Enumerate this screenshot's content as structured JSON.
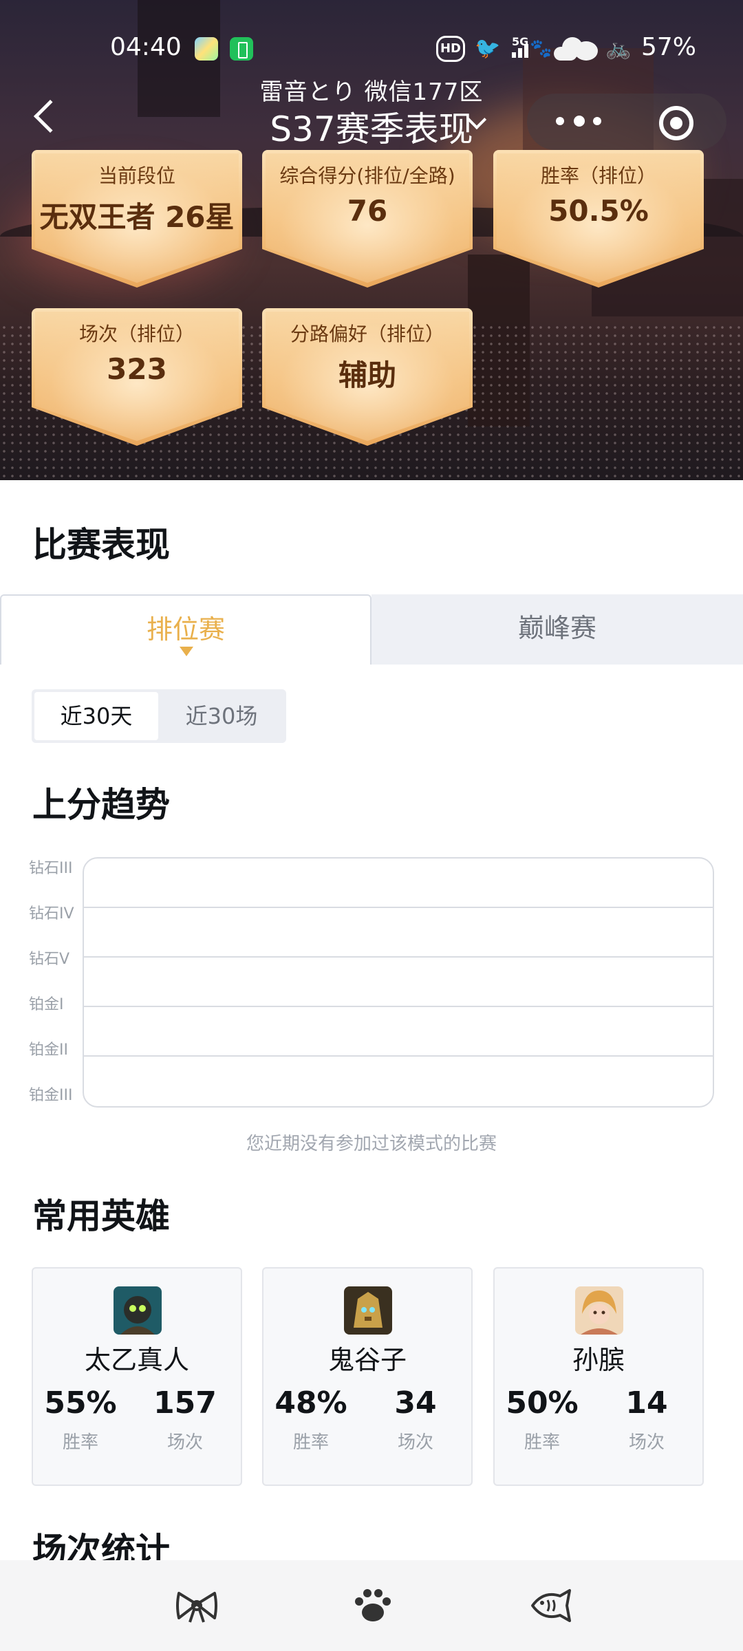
{
  "status_bar": {
    "time": "04:40",
    "hd": "HD",
    "network": "5G",
    "battery": "57%"
  },
  "header": {
    "subtitle": "雷音とり 微信177区",
    "title": "S37赛季表现"
  },
  "stats": [
    {
      "label": "当前段位",
      "value": "无双王者 26星"
    },
    {
      "label": "综合得分(排位/全路)",
      "value": "76"
    },
    {
      "label": "胜率（排位）",
      "value": "50.5%"
    },
    {
      "label": "场次（排位）",
      "value": "323"
    },
    {
      "label": "分路偏好（排位）",
      "value": "辅助"
    }
  ],
  "performance": {
    "title": "比赛表现"
  },
  "tabs": [
    {
      "label": "排位赛",
      "active": true
    },
    {
      "label": "巅峰赛",
      "active": false
    }
  ],
  "range_toggle": [
    {
      "label": "近30天",
      "active": true
    },
    {
      "label": "近30场",
      "active": false
    }
  ],
  "trend": {
    "title": "上分趋势",
    "empty_note": "您近期没有参加过该模式的比赛"
  },
  "chart_data": {
    "type": "line",
    "y_categories": [
      "钻石III",
      "钻石IV",
      "钻石V",
      "铂金I",
      "铂金II",
      "铂金III"
    ],
    "series": [],
    "grid": true
  },
  "heroes": {
    "title": "常用英雄",
    "win_rate_label": "胜率",
    "matches_label": "场次",
    "items": [
      {
        "name": "太乙真人",
        "win_rate": "55%",
        "matches": "157"
      },
      {
        "name": "鬼谷子",
        "win_rate": "48%",
        "matches": "34"
      },
      {
        "name": "孙膑",
        "win_rate": "50%",
        "matches": "14"
      }
    ]
  },
  "match_stats": {
    "title": "场次统计"
  },
  "bottom_nav": [
    {
      "icon": "bow-icon"
    },
    {
      "icon": "paw-icon"
    },
    {
      "icon": "fish-icon"
    }
  ],
  "colors": {
    "accent": "#e9b04c",
    "badge": "#f4c17e"
  }
}
